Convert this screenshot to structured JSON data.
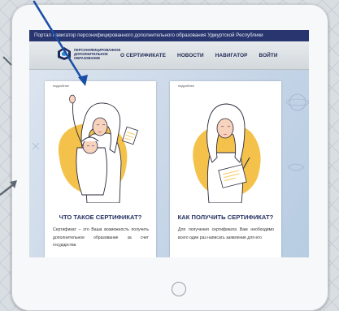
{
  "header": {
    "portal_title": "Портал навигатор персонифицированного дополнительного образования Удмуртской Республики"
  },
  "logo": {
    "text": "Персонифицированное дополнительное образование"
  },
  "nav": {
    "items": [
      {
        "label": "О СЕРТИФИКАТЕ"
      },
      {
        "label": "НОВОСТИ"
      },
      {
        "label": "НАВИГАТОР"
      },
      {
        "label": "ВОЙТИ"
      }
    ]
  },
  "cards": [
    {
      "small": "подробнее",
      "title": "ЧТО ТАКОЕ СЕРТИФИКАТ?",
      "text": "Сертификат – это Ваша возможность получить дополнительное образование за счет государства"
    },
    {
      "small": "подробнее",
      "title": "КАК ПОЛУЧИТЬ СЕРТИФИКАТ?",
      "text": "Для получения сертификата Вам необходимо всего один раз написать заявление для его"
    }
  ],
  "colors": {
    "header_bg": "#29356e",
    "title_color": "#1f2c5e",
    "accent_yellow": "#f4c24a",
    "pointer_blue": "#1b4ea8"
  }
}
